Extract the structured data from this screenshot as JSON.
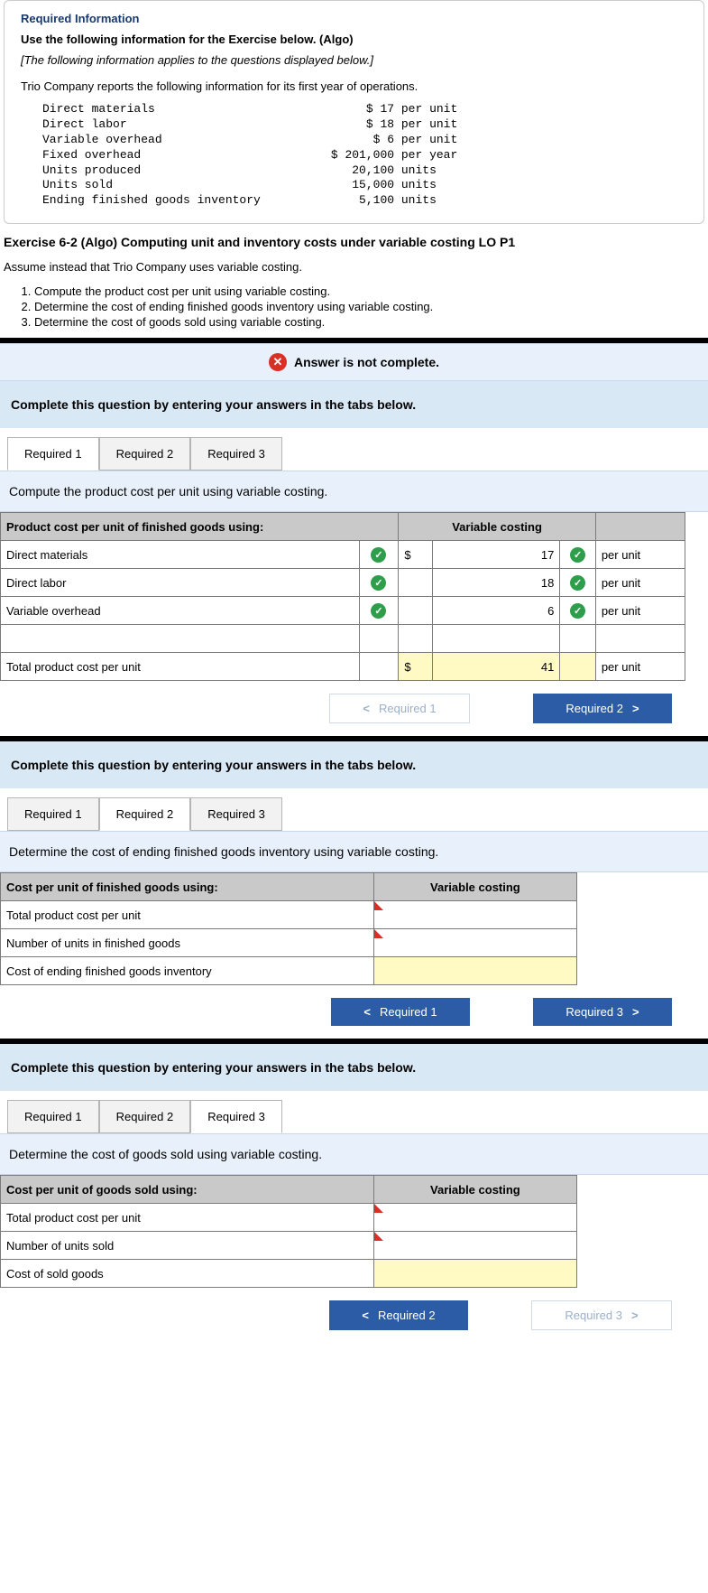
{
  "info": {
    "section_header": "Required Information",
    "instr": "Use the following information for the Exercise below. (Algo)",
    "applies": "[The following information applies to the questions displayed below.]",
    "intro": "Trio Company reports the following information for its first year of operations.",
    "mono": "Direct materials                              $ 17 per unit\nDirect labor                                  $ 18 per unit\nVariable overhead                              $ 6 per unit\nFixed overhead                           $ 201,000 per year\nUnits produced                              20,100 units\nUnits sold                                  15,000 units\nEnding finished goods inventory              5,100 units"
  },
  "exercise": {
    "title": "Exercise 6-2 (Algo) Computing unit and inventory costs under variable costing LO P1",
    "assume": "Assume instead that Trio Company uses variable costing.",
    "tasks": [
      "Compute the product cost per unit using variable costing.",
      "Determine the cost of ending finished goods inventory using variable costing.",
      "Determine the cost of goods sold using variable costing."
    ]
  },
  "banner": "Answer is not complete.",
  "complete_msg": "Complete this question by entering your answers in the tabs below.",
  "tabs": {
    "t1": "Required 1",
    "t2": "Required 2",
    "t3": "Required 3"
  },
  "r1": {
    "desc": "Compute the product cost per unit using variable costing.",
    "h1": "Product cost per unit of finished goods using:",
    "h2": "Variable costing",
    "dm": "Direct materials",
    "dl": "Direct labor",
    "vo": "Variable overhead",
    "total": "Total product cost per unit",
    "v_dm": "17",
    "v_dl": "18",
    "v_vo": "6",
    "v_total": "41",
    "unit": "per unit",
    "dollar": "$",
    "prev": "Required 1",
    "next": "Required 2"
  },
  "r2": {
    "desc": "Determine the cost of ending finished goods inventory using variable costing.",
    "h1": "Cost per unit of finished goods using:",
    "h2": "Variable costing",
    "r1": "Total product cost per unit",
    "r2": "Number of units in finished goods",
    "r3": "Cost of ending finished goods inventory",
    "prev": "Required 1",
    "next": "Required 3"
  },
  "r3": {
    "desc": "Determine the cost of goods sold using variable costing.",
    "h1": "Cost per unit of goods sold using:",
    "h2": "Variable costing",
    "r1": "Total product cost per unit",
    "r2": "Number of units sold",
    "r3": "Cost of sold goods",
    "prev": "Required 2",
    "next": "Required 3"
  }
}
